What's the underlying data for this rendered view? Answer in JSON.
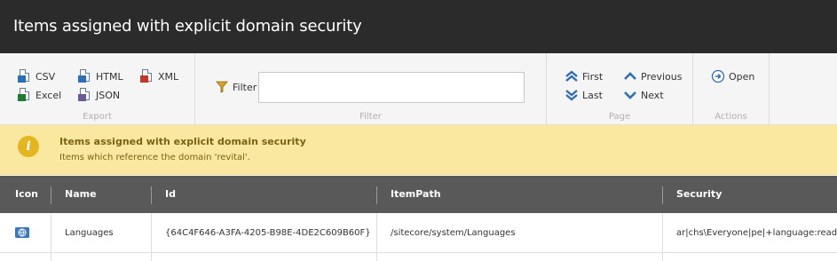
{
  "title": "Items assigned with explicit domain security",
  "ribbon": {
    "export": {
      "caption": "Export",
      "csv": "CSV",
      "excel": "Excel",
      "html": "HTML",
      "json": "JSON",
      "xml": "XML"
    },
    "filter": {
      "caption": "Filter",
      "label": "Filter",
      "value": "",
      "placeholder": ""
    },
    "page": {
      "caption": "Page",
      "first": "First",
      "last": "Last",
      "previous": "Previous",
      "next": "Next"
    },
    "actions": {
      "caption": "Actions",
      "open": "Open"
    }
  },
  "message": {
    "icon": "info-icon",
    "title": "Items assigned with explicit domain security",
    "text": "Items which reference the domain 'revital'."
  },
  "table": {
    "columns": [
      "Icon",
      "Name",
      "Id",
      "ItemPath",
      "Security"
    ],
    "rows": [
      {
        "icon": "globe-icon",
        "name": "Languages",
        "id": "{64C4F646-A3FA-4205-B98E-4DE2C609B60F}",
        "path": "/sitecore/system/Languages",
        "security": "ar|chs\\Everyone|pe|+language:read|+"
      }
    ]
  },
  "colors": {
    "titlebar": "#2b2b2b",
    "ribbon": "#f5f5f5",
    "message_bg": "#fae8a0",
    "table_header": "#595959",
    "nav_arrow": "#2f6db5"
  }
}
